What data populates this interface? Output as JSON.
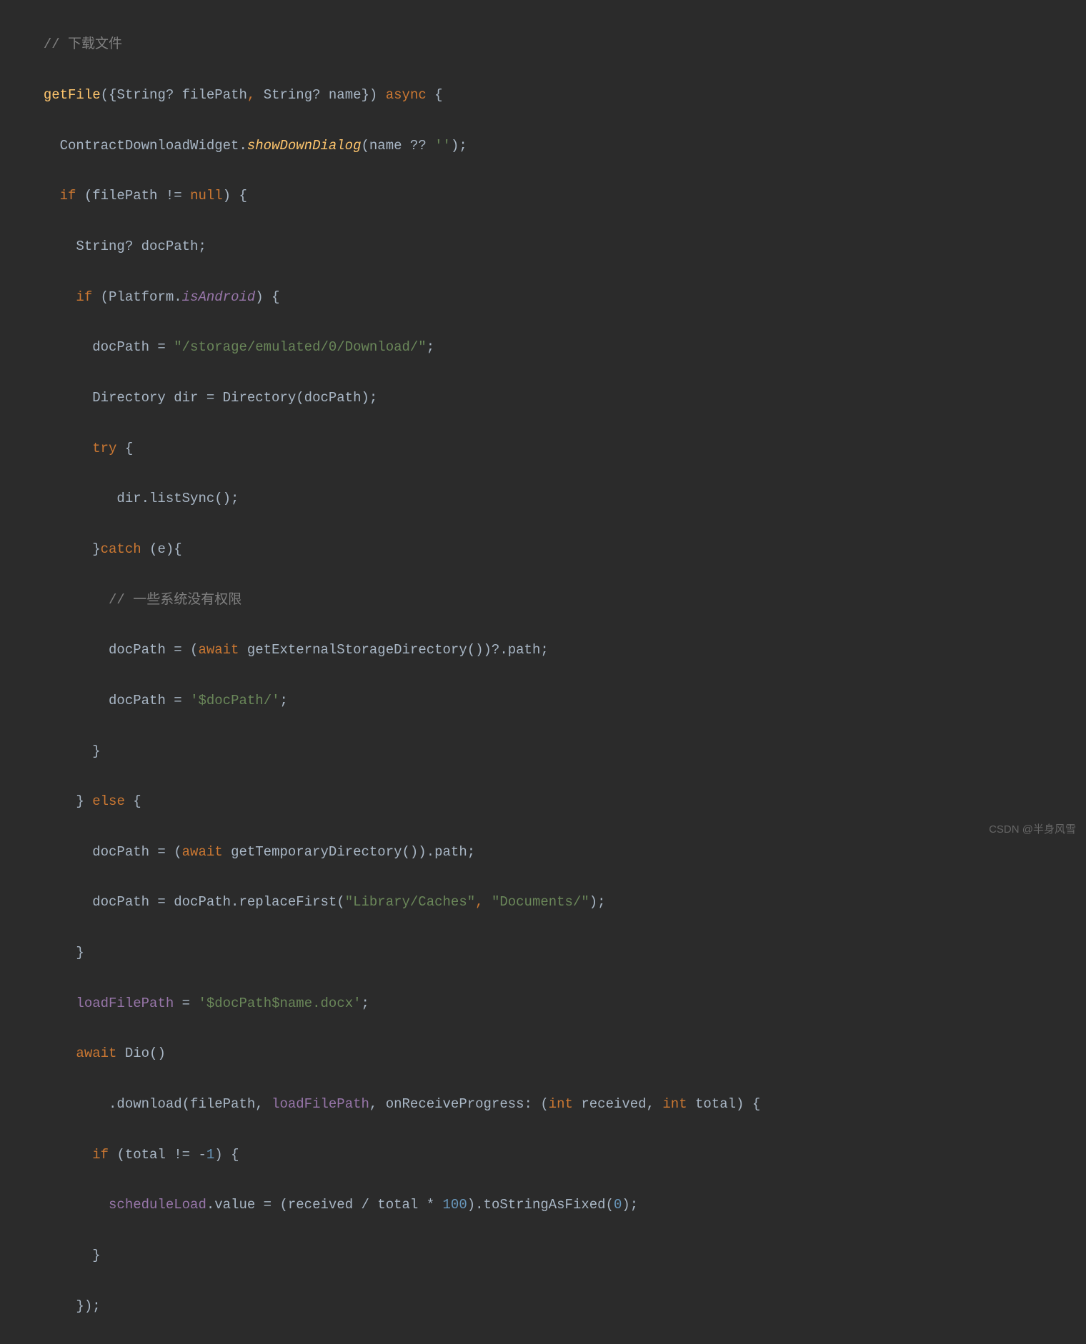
{
  "code": {
    "l1": {
      "ind": "  ",
      "comment": "// 下载文件"
    },
    "l2": {
      "ind": "  ",
      "fn": "getFile",
      "p1": "({String? filePath",
      "p2": ", ",
      "p3": "String? name})",
      "sp": " ",
      "async": "async",
      "brace": " {"
    },
    "l3": {
      "ind": "    ",
      "cls": "ContractDownloadWidget.",
      "method": "showDownDialog",
      "args_open": "(name ?? ",
      "str": "''",
      "args_close": ");"
    },
    "l4": {
      "ind": "    ",
      "kw": "if ",
      "cond": "(filePath != ",
      "null": "null",
      "close": ") {"
    },
    "l5": {
      "ind": "      ",
      "txt": "String? docPath;"
    },
    "l6": {
      "ind": "      ",
      "kw": "if ",
      "open": "(Platform.",
      "prop": "isAndroid",
      "close": ") {"
    },
    "l7": {
      "ind": "        ",
      "var": "docPath = ",
      "str": "\"/storage/emulated/0/Download/\"",
      "semi": ";"
    },
    "l8": {
      "ind": "        ",
      "txt": "Directory dir = Directory(docPath);"
    },
    "l9": {
      "ind": "        ",
      "kw": "try ",
      "brace": "{"
    },
    "l10": {
      "ind": "           ",
      "txt": "dir.listSync();"
    },
    "l11": {
      "ind": "        ",
      "close": "}",
      "kw": "catch ",
      "args": "(e){"
    },
    "l12": {
      "ind": "          ",
      "comment": "// 一些系统没有权限"
    },
    "l13": {
      "ind": "          ",
      "pre": "docPath = (",
      "kw": "await ",
      "call": "getExternalStorageDirectory())?.path;"
    },
    "l14": {
      "ind": "          ",
      "pre": "docPath = ",
      "s1": "'",
      "s2": "$docPath",
      "s3": "/'",
      "semi": ";"
    },
    "l15": {
      "ind": "        ",
      "brace": "}"
    },
    "l16": {
      "ind": "      ",
      "close": "} ",
      "kw": "else ",
      "brace": "{"
    },
    "l17": {
      "ind": "        ",
      "pre": "docPath = (",
      "kw": "await ",
      "call": "getTemporaryDirectory()).path;"
    },
    "l18": {
      "ind": "        ",
      "pre": "docPath = docPath.replaceFirst(",
      "s1": "\"Library/Caches\"",
      "comma": ", ",
      "s2": "\"Documents/\"",
      "close": ");"
    },
    "l19": {
      "ind": "      ",
      "brace": "}"
    },
    "l20": {
      "ind": "      ",
      "var": "loadFilePath",
      "eq": " = ",
      "s1": "'",
      "s2": "$docPath$name",
      "s3": ".docx'",
      "semi": ";"
    },
    "l21": {
      "ind": "      ",
      "kw": "await ",
      "call": "Dio()"
    },
    "l22": {
      "ind": "          ",
      "dot": ".download(filePath, ",
      "arg": "loadFilePath",
      "named": ", onReceiveProgress: (",
      "type1": "int ",
      "p1": "received, ",
      "type2": "int ",
      "p2": "total) {"
    },
    "l23": {
      "ind": "        ",
      "kw": "if ",
      "cond": "(total != -",
      "num": "1",
      "close": ") {"
    },
    "l24": {
      "ind": "          ",
      "obj": "scheduleLoad",
      "dotval": ".value = (received / total * ",
      "n1": "100",
      "mid": ").toStringAsFixed(",
      "n2": "0",
      "close": ");"
    },
    "l25": {
      "ind": "        ",
      "brace": "}"
    },
    "l26": {
      "ind": "      ",
      "brace": "});"
    }
  },
  "watermark": "CSDN @半身风雪"
}
